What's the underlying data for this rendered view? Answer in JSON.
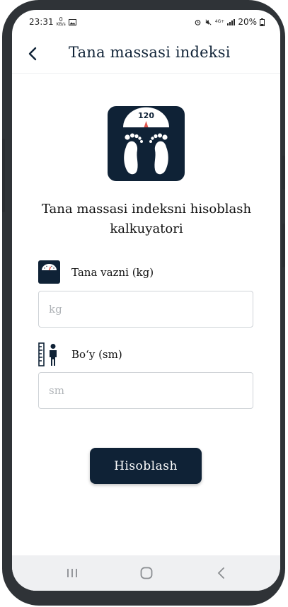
{
  "status_bar": {
    "time": "23:31",
    "net_speed_value": "0",
    "net_speed_unit": "KB/s",
    "signal_type": "4G+",
    "battery": "20%"
  },
  "app_bar": {
    "title": "Tana massasi indeksi",
    "back_icon": "arrow-left-icon"
  },
  "illustration": {
    "scale_reading": "120",
    "icon": "bathroom-scale-icon"
  },
  "heading": "Tana massasi indeksni hisoblash kalkuyatori",
  "weight_field": {
    "label": "Tana vazni (kg)",
    "placeholder": "kg",
    "value": "",
    "icon": "scale-icon"
  },
  "height_field": {
    "label": "Bo‘y (sm)",
    "placeholder": "sm",
    "value": "",
    "icon": "height-ruler-person-icon"
  },
  "calculate_button": {
    "label": "Hisoblash"
  },
  "nav_bar": {
    "recents_icon": "recents-icon",
    "home_icon": "home-icon",
    "back_icon": "back-icon"
  },
  "colors": {
    "primary": "#0f2236",
    "scale_needle": "#e0584f",
    "frame": "#2f3337"
  }
}
